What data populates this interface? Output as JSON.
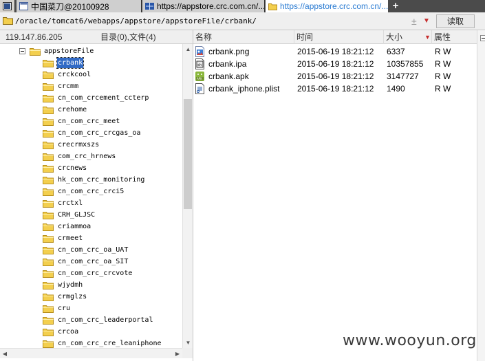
{
  "tabs": [
    {
      "label": "中国菜刀@20100928",
      "icon": "app-window-icon",
      "active": false
    },
    {
      "label": "https://appstore.crc.com.cn/...",
      "icon": "globe-icon",
      "active": false
    },
    {
      "label": "https://appstore.crc.com.cn/...",
      "icon": "folder-icon",
      "active": true
    }
  ],
  "new_tab_label": "+",
  "address": {
    "path": "/oracle/tomcat6/webapps/appstore/appstoreFile/crbank/",
    "plus_minus": "±",
    "dropdown": "▼",
    "read_button": "读取"
  },
  "status": {
    "ip": "119.147.86.205",
    "summary": "目录(0),文件(4)"
  },
  "tree": {
    "root": "appstoreFile",
    "selected": "crbank",
    "items": [
      "crbank",
      "crckcool",
      "crcmm",
      "cn_com_crcement_ccterp",
      "crehome",
      "cn_com_crc_meet",
      "cn_com_crc_crcgas_oa",
      "crecrmxszs",
      "com_crc_hrnews",
      "crcnews",
      "hk_com_crc_monitoring",
      "cn_com_crc_crci5",
      "crctxl",
      "CRH_GLJSC",
      "criammoa",
      "crmeet",
      "cn_com_crc_oa_UAT",
      "cn_com_crc_oa_SIT",
      "cn_com_crc_crcvote",
      "wjydmh",
      "crmglzs",
      "cru",
      "cn_com_crc_leaderportal",
      "crcoa",
      "cn_com_crc_cre_leaniphone"
    ]
  },
  "columns": {
    "name": "名称",
    "time": "时间",
    "size": "大小",
    "sort_marker": "▼",
    "attr": "属性"
  },
  "files": [
    {
      "name": "crbank.png",
      "time": "2015-06-19 18:21:12",
      "size": "6337",
      "attr": "R W",
      "icon": "image-file-icon"
    },
    {
      "name": "crbank.ipa",
      "time": "2015-06-19 18:21:12",
      "size": "10357855",
      "attr": "R W",
      "icon": "ipa-file-icon"
    },
    {
      "name": "crbank.apk",
      "time": "2015-06-19 18:21:12",
      "size": "3147727",
      "attr": "R W",
      "icon": "android-apk-icon"
    },
    {
      "name": "crbank_iphone.plist",
      "time": "2015-06-19 18:21:12",
      "size": "1490",
      "attr": "R W",
      "icon": "plist-file-icon"
    }
  ],
  "watermark": "www.wooyun.org",
  "colors": {
    "selection": "#316ac5",
    "folder": "#f3cf4e",
    "active_tab_text": "#2a7bd2"
  }
}
